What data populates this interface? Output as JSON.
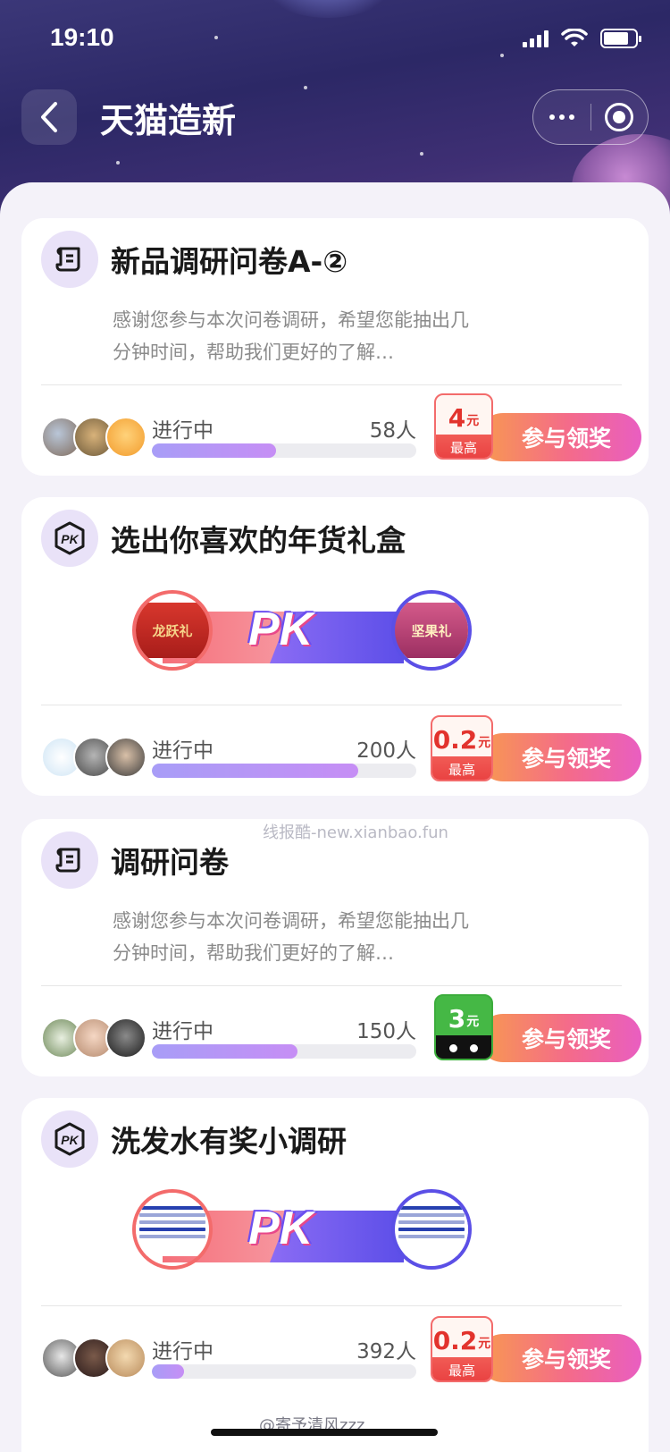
{
  "status_bar": {
    "time": "19:10"
  },
  "nav": {
    "title": "天猫造新"
  },
  "cards": [
    {
      "type": "survey",
      "title": "新品调研问卷A-②",
      "desc": "感谢您参与本次问卷调研，希望您能抽出几分钟时间，帮助我们更好的了解…",
      "status": "进行中",
      "count": "58人",
      "progress": 0.47,
      "reward_amount": "4",
      "reward_unit": "元",
      "reward_label": "最高",
      "button": "参与领奖"
    },
    {
      "type": "pk",
      "title": "选出你喜欢的年货礼盒",
      "left_item_text": "龙跃礼",
      "right_item_text": "坚果礼",
      "pk_text": "PK",
      "status": "进行中",
      "count": "200人",
      "progress": 0.78,
      "reward_amount": "0.2",
      "reward_unit": "元",
      "reward_label": "最高",
      "button": "参与领奖"
    },
    {
      "type": "survey",
      "title": "调研问卷",
      "desc": "感谢您参与本次问卷调研，希望您能抽出几分钟时间，帮助我们更好的了解…",
      "status": "进行中",
      "count": "150人",
      "progress": 0.55,
      "reward_amount": "3",
      "reward_unit": "元",
      "button": "参与领奖"
    },
    {
      "type": "pk",
      "title": "洗发水有奖小调研",
      "pk_text": "PK",
      "status": "进行中",
      "count": "392人",
      "progress": 0.12,
      "reward_amount": "0.2",
      "reward_unit": "元",
      "reward_label": "最高",
      "button": "参与领奖"
    }
  ],
  "watermark": "线报酷-new.xianbao.fun",
  "weibo_tag": "@寄予清风zzz"
}
